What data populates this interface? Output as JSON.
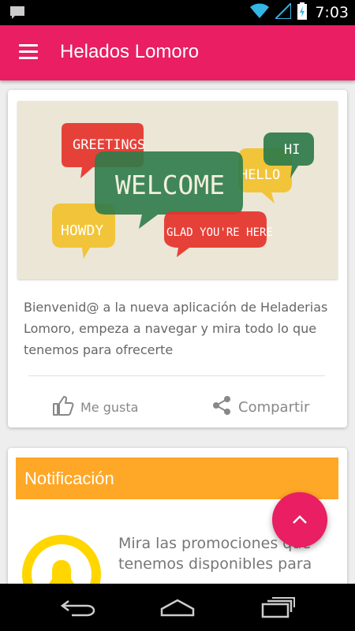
{
  "status_bar": {
    "time": "7:03",
    "icons": [
      "notification-icon",
      "wifi-icon",
      "signal-icon",
      "battery-charging-icon"
    ]
  },
  "app_bar": {
    "title": "Helados Lomoro",
    "menu_icon": "menu-icon",
    "color": "#e91e63"
  },
  "welcome_card": {
    "image": {
      "words": [
        "GREETINGS",
        "WELCOME",
        "HI",
        "HELLO",
        "HOWDY",
        "GLAD YOU'RE HERE"
      ]
    },
    "text": "Bienvenid@ a la nueva aplicación de Heladerias Lomoro, empeza a navegar y mira todo lo que tenemos para ofrecerte",
    "like_label": "Me gusta",
    "share_label": "Compartir"
  },
  "notification_card": {
    "title": "Notificación",
    "header_color": "#ffa726",
    "text": "Mira las promociones que tenemos disponibles para"
  },
  "fab": {
    "icon": "chevron-up-icon"
  },
  "nav_bar": {
    "icons": [
      "back-icon",
      "home-icon",
      "recents-icon"
    ]
  }
}
